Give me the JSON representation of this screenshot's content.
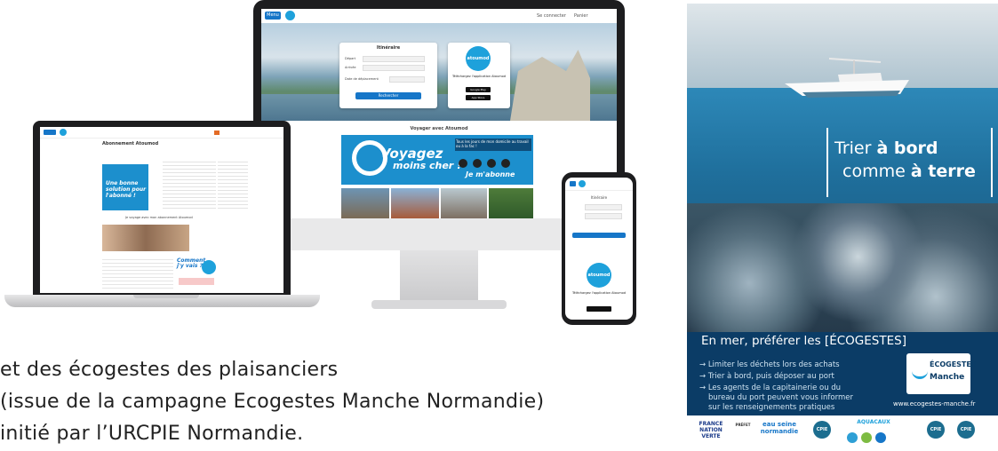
{
  "paragraph": {
    "line1": "et des écogestes des plaisanciers",
    "line2": "(issue de la campagne Ecogestes Manche Normandie)",
    "line3": "initié par l’URCPIE Normandie."
  },
  "monitor": {
    "nav_menu": "Menu",
    "nav_links": [
      "Se connecter",
      "Panier"
    ],
    "search_card_title": "Itinéraire",
    "field_from": "Départ",
    "field_to": "Arrivée",
    "field_date": "Date de déplacement",
    "search_button": "Rechercher",
    "app_logo_line1": "atoumod",
    "app_promo": "Téléchargez l'application Atoumod",
    "store_google": "Google Play",
    "store_apple": "App Store",
    "section_title": "Voyager avec Atoumod",
    "banner_line1": "Voyagez",
    "banner_line2": "moins cher !",
    "banner_side": "Tous les jours de mon domicile au travail ou à la fac !",
    "banner_cta": "Je m'abonne"
  },
  "laptop": {
    "page_title": "Abonnement Atoumod",
    "promo_title": "Une bonne solution pour l'abonné !",
    "section_subtitle": "Je voyage avec mon abonnement Atoumod",
    "promo2": "Comment j'y vais ?"
  },
  "phone": {
    "card_title": "Itinéraire",
    "logo": "atoumod",
    "promo": "Téléchargez l'application Atoumod"
  },
  "poster": {
    "slogan_line1_a": "Trier ",
    "slogan_line1_b": "à bord",
    "slogan_line2_a": "comme ",
    "slogan_line2_b": "à terre",
    "headline": "En mer, préférer les [ÉCOGESTES]",
    "bullets": [
      "→ Limiter les déchets lors des achats",
      "→ Trier à bord, puis déposer au port",
      "→ Les agents de la capitainerie ou du",
      "bureau du port peuvent vous informer",
      "sur les renseignements pratiques"
    ],
    "badge_top": "ÉCOGESTES",
    "badge_bottom": "Manche",
    "url": "www.ecogestes-manche.fr",
    "logos": [
      "FRANCE NATION VERTE",
      "PRÉFET",
      "eau seine normandie",
      "CPIE",
      "AQUACAUX",
      "CPIE",
      "CPIE"
    ]
  },
  "colors": {
    "brand_blue": "#1676c8",
    "atoumod_blue": "#1ea1db",
    "poster_navy": "#0b3c66"
  }
}
